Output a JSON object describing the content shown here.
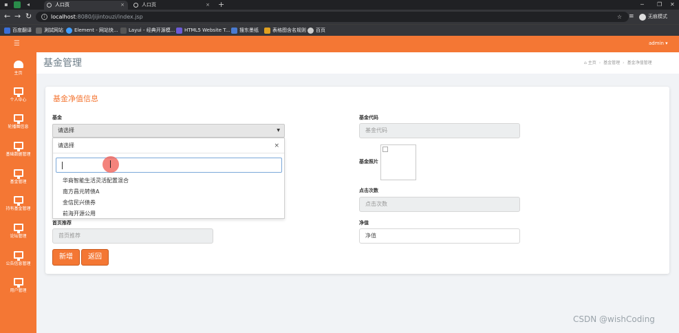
{
  "browser": {
    "tabs": [
      {
        "label": "人口页",
        "active": true
      },
      {
        "label": "人口页",
        "active": false
      }
    ],
    "url_host": "localhost",
    "url_path": ":8080/jijintouzi/index.jsp",
    "profile_label": "无痕模式",
    "bookmarks": [
      "百度翻译",
      "測試网站",
      "Element - 网站快...",
      "Layui - 经典开源模...",
      "HTML5 Website T...",
      "搜东墨纸",
      "表格图含名规则",
      "百页"
    ]
  },
  "header": {
    "user": "admin ▾",
    "menu_icon": "hamburger-icon"
  },
  "sidebar": {
    "items": [
      {
        "label": "主页",
        "icon": "dashboard-icon"
      },
      {
        "label": "个人中心",
        "icon": "monitor-icon"
      },
      {
        "label": "轮播图信息",
        "icon": "monitor-icon"
      },
      {
        "label": "基础数据管理",
        "icon": "monitor-icon"
      },
      {
        "label": "基金管理",
        "icon": "monitor-icon"
      },
      {
        "label": "持有基金管理",
        "icon": "monitor-icon"
      },
      {
        "label": "论坛管理",
        "icon": "monitor-icon"
      },
      {
        "label": "公告信息管理",
        "icon": "monitor-icon"
      },
      {
        "label": "用户管理",
        "icon": "monitor-icon"
      }
    ]
  },
  "page": {
    "title": "基金管理",
    "breadcrumb": {
      "home": "主页",
      "level1": "基金管理",
      "level2": "基金净值管理"
    }
  },
  "form": {
    "title": "基金净值信息",
    "fund_label": "基金",
    "fund_select": "请选择",
    "dropdown": {
      "selected": "请选择",
      "clear": "×",
      "options": [
        "华商智能生活灵活配置混合",
        "南方昌元转债A",
        "金信民兴债券",
        "前海开源公用"
      ]
    },
    "code_label": "基金代码",
    "code_placeholder": "基金代码",
    "photo_label": "基金照片",
    "clicks_label": "点击次数",
    "clicks_placeholder": "点击次数",
    "recommend_label": "首页推荐",
    "recommend_placeholder": "首页推荐",
    "nav_label": "净值",
    "nav_value": "净值",
    "add_button": "新增",
    "back_button": "返回"
  },
  "watermark": "CSDN @wishCoding",
  "colors": {
    "accent": "#f47734",
    "chrome_dark": "#202124",
    "chrome": "#35363a"
  }
}
